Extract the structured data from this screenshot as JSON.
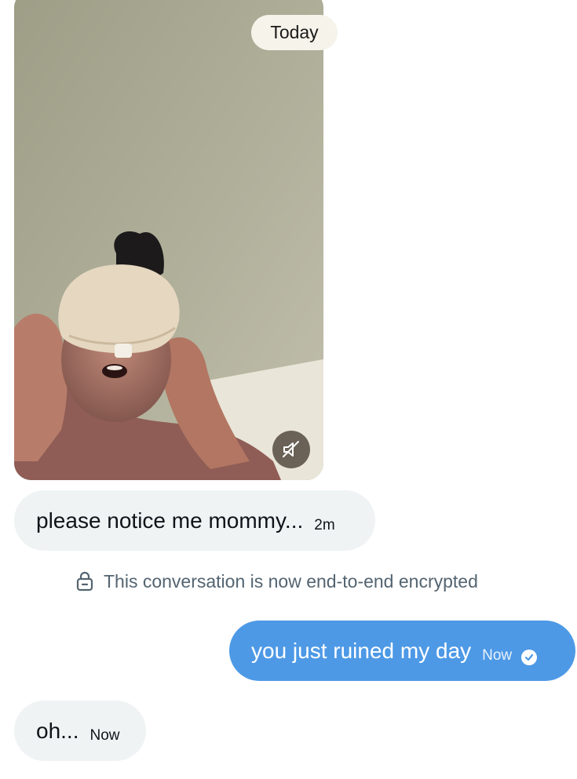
{
  "date_separator": "Today",
  "video": {
    "mute_icon": "speaker-muted-icon"
  },
  "messages": [
    {
      "direction": "incoming",
      "text": "please notice me mommy...",
      "time": "2m"
    },
    {
      "direction": "outgoing",
      "text": "you just ruined my day",
      "time": "Now",
      "status_icon": "read-check-icon"
    },
    {
      "direction": "incoming",
      "text": "oh...",
      "time": "Now"
    }
  ],
  "notice": {
    "icon": "lock-icon",
    "text": "This conversation is now end-to-end encrypted"
  },
  "colors": {
    "outgoing_bubble": "#4d99e6",
    "incoming_bubble": "#eff3f4",
    "notice_text": "#536471"
  }
}
